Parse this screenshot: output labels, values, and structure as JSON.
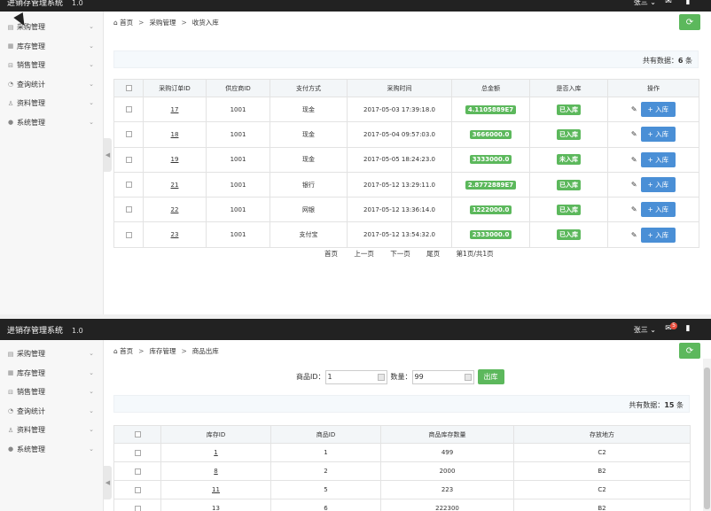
{
  "app": {
    "title": "进销存管理系统",
    "version": "1.0",
    "user": "张三",
    "mail_badge": "5"
  },
  "sidebar": {
    "items": [
      {
        "label": "采购管理"
      },
      {
        "label": "库存管理"
      },
      {
        "label": "销售管理"
      },
      {
        "label": "查询统计"
      },
      {
        "label": "资料管理"
      },
      {
        "label": "系统管理"
      }
    ]
  },
  "screen1": {
    "breadcrumb": {
      "home": "首页",
      "section": "采购管理",
      "page": "收货入库"
    },
    "total_label": "共有数据：",
    "total_value": "6",
    "total_unit": " 条",
    "columns": [
      "采购订单ID",
      "供应商ID",
      "支付方式",
      "采购时间",
      "总金额",
      "是否入库",
      "操作"
    ],
    "rows": [
      {
        "id": "17",
        "supplier": "1001",
        "pay": "现金",
        "time": "2017-05-03 17:39:18.0",
        "amount": "4.1105889E7",
        "status": "已入库"
      },
      {
        "id": "18",
        "supplier": "1001",
        "pay": "现金",
        "time": "2017-05-04 09:57:03.0",
        "amount": "3666000.0",
        "status": "已入库"
      },
      {
        "id": "19",
        "supplier": "1001",
        "pay": "现金",
        "time": "2017-05-05 18:24:23.0",
        "amount": "3333000.0",
        "status": "未入库"
      },
      {
        "id": "21",
        "supplier": "1001",
        "pay": "银行",
        "time": "2017-05-12 13:29:11.0",
        "amount": "2.8772889E7",
        "status": "已入库"
      },
      {
        "id": "22",
        "supplier": "1001",
        "pay": "网银",
        "time": "2017-05-12 13:36:14.0",
        "amount": "1222000.0",
        "status": "已入库"
      },
      {
        "id": "23",
        "supplier": "1001",
        "pay": "支付宝",
        "time": "2017-05-12 13:54:32.0",
        "amount": "2333000.0",
        "status": "已入库"
      }
    ],
    "action_label": "+ 入库",
    "pager": {
      "first": "首页",
      "prev": "上一页",
      "next": "下一页",
      "last": "尾页",
      "info": "第1页/共1页"
    }
  },
  "screen2": {
    "breadcrumb": {
      "home": "首页",
      "section": "库存管理",
      "page": "商品出库"
    },
    "form": {
      "goods_id_label": "商品ID：",
      "goods_id_value": "1",
      "qty_label": "数量：",
      "qty_value": "99",
      "submit_label": "出库"
    },
    "total_label": "共有数据：",
    "total_value": "15",
    "total_unit": " 条",
    "columns": [
      "库存ID",
      "商品ID",
      "商品库存数量",
      "存放地方"
    ],
    "rows": [
      {
        "id": "1",
        "goods": "1",
        "qty": "499",
        "place": "C2"
      },
      {
        "id": "8",
        "goods": "2",
        "qty": "2000",
        "place": "B2"
      },
      {
        "id": "11",
        "goods": "5",
        "qty": "223",
        "place": "C2"
      },
      {
        "id": "13",
        "goods": "6",
        "qty": "222300",
        "place": "B2"
      }
    ]
  },
  "colors": {
    "topbar": "#222222",
    "green": "#5cb85c",
    "blue": "#4a8fd6",
    "badge": "#e74c3c"
  },
  "icons": [
    "home-icon",
    "refresh-icon",
    "mail-icon",
    "shirt-icon",
    "pencil-icon",
    "calendar-icon",
    "chevron-down-icon",
    "collapse-arrow-icon"
  ]
}
